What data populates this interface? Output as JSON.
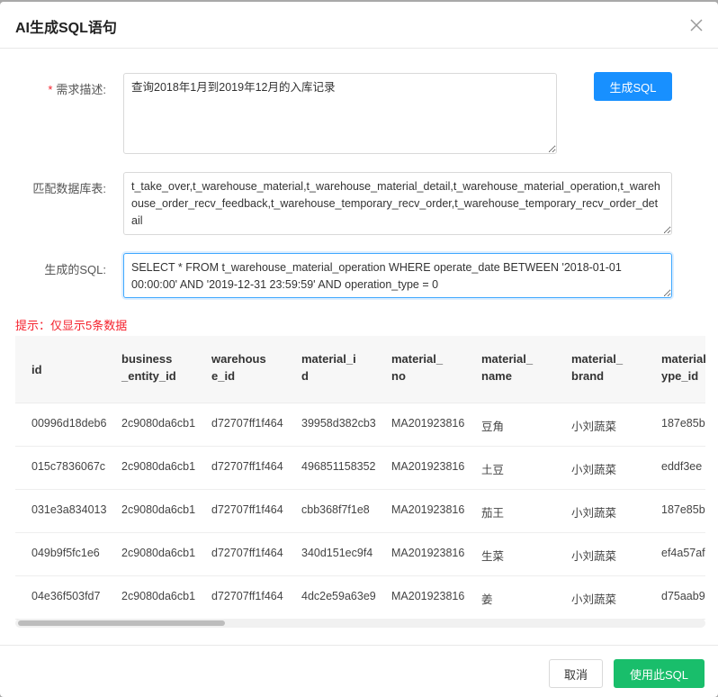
{
  "dialog": {
    "title": "AI生成SQL语句"
  },
  "form": {
    "requirement_label": "需求描述:",
    "requirement_value": "查询2018年1月到2019年12月的入库记录",
    "tables_label": "匹配数据库表:",
    "tables_value": "t_take_over,t_warehouse_material,t_warehouse_material_detail,t_warehouse_material_operation,t_warehouse_order_recv_feedback,t_warehouse_temporary_recv_order,t_warehouse_temporary_recv_order_detail",
    "sql_label": "生成的SQL:",
    "sql_value": "SELECT * FROM t_warehouse_material_operation WHERE operate_date BETWEEN '2018-01-01 00:00:00' AND '2019-12-31 23:59:59' AND operation_type = 0",
    "generate_button": "生成SQL"
  },
  "hint": "提示：仅显示5条数据",
  "table": {
    "headers": [
      "id",
      "business_entity_id",
      "warehouse_id",
      "material_id",
      "material_no",
      "material_name",
      "material_brand",
      "material_type_id"
    ],
    "rows": [
      [
        "00996d18deb6",
        "2c9080da6cb1",
        "d72707ff1f464",
        "39958d382cb3",
        "MA201923816",
        "豆角",
        "小刘蔬菜",
        "187e85b"
      ],
      [
        "015c7836067c",
        "2c9080da6cb1",
        "d72707ff1f464",
        "496851158352",
        "MA201923816",
        "土豆",
        "小刘蔬菜",
        "eddf3ee"
      ],
      [
        "031e3a834013",
        "2c9080da6cb1",
        "d72707ff1f464",
        "cbb368f7f1e8",
        "MA201923816",
        "茄王",
        "小刘蔬菜",
        "187e85b"
      ],
      [
        "049b9f5fc1e6",
        "2c9080da6cb1",
        "d72707ff1f464",
        "340d151ec9f4",
        "MA201923816",
        "生菜",
        "小刘蔬菜",
        "ef4a57af"
      ],
      [
        "04e36f503fd7",
        "2c9080da6cb1",
        "d72707ff1f464",
        "4dc2e59a63e9",
        "MA201923816",
        "姜",
        "小刘蔬菜",
        "d75aab9"
      ]
    ]
  },
  "footer": {
    "cancel_button": "取消",
    "use_button": "使用此SQL"
  },
  "colors": {
    "primary": "#1890ff",
    "success": "#19be6b",
    "danger": "#f5222d"
  }
}
